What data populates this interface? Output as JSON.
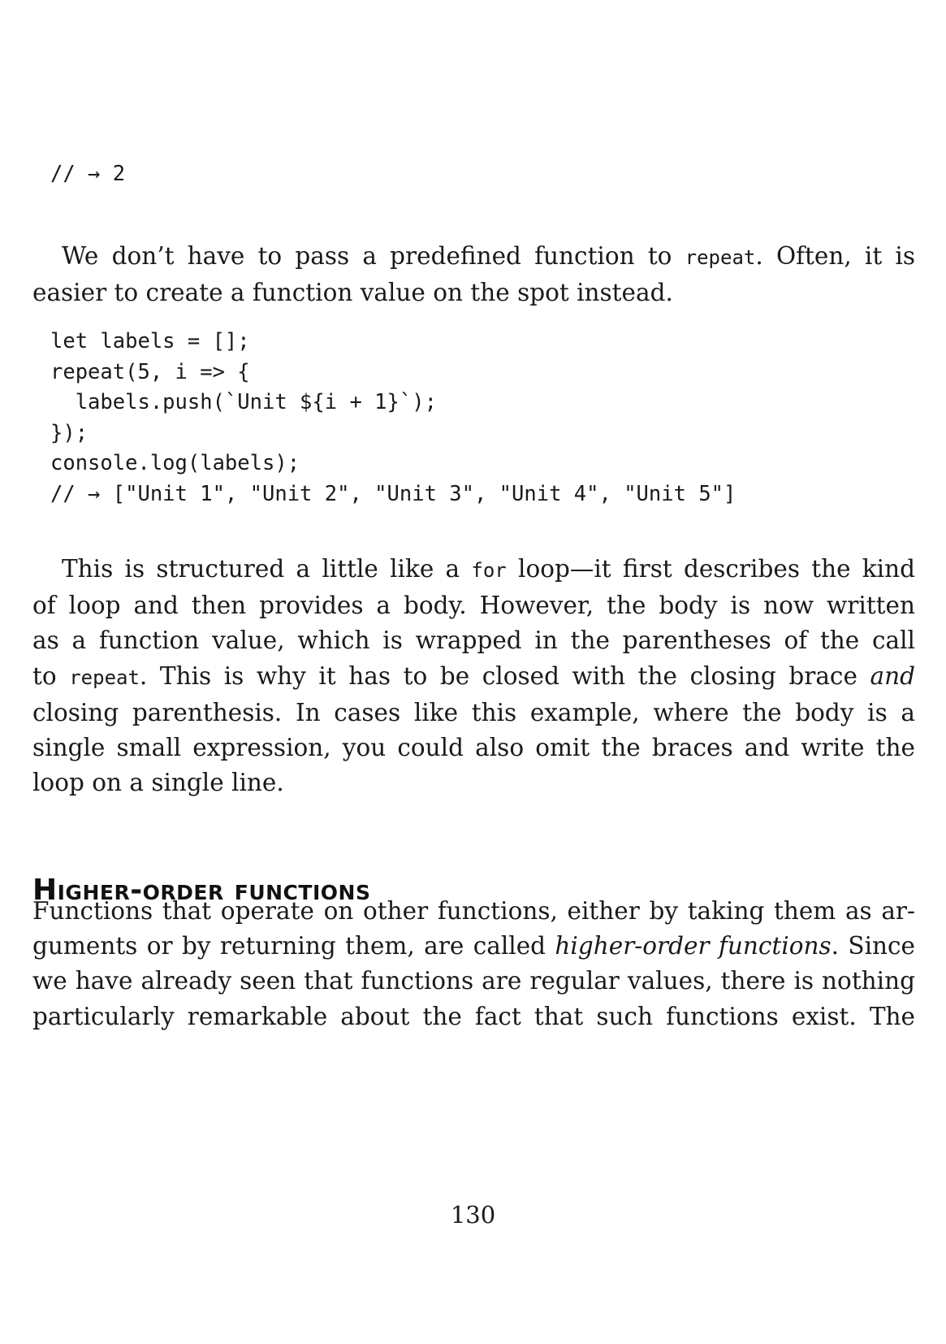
{
  "code_top": "// → 2",
  "para1": {
    "l1_a": "We don’t have to pass a predefined function to ",
    "l1_code": "repeat",
    "l1_b": ". Often, it is",
    "l2": "easier to create a function value on the spot instead."
  },
  "code_block": [
    "let labels = [];",
    "repeat(5, i => {",
    "  labels.push(`Unit ${i + 1}`);",
    "});",
    "console.log(labels);",
    "// → [\"Unit 1\", \"Unit 2\", \"Unit 3\", \"Unit 4\", \"Unit 5\"]"
  ],
  "para2": {
    "l1_a": "This is structured a little like a ",
    "l1_code": "for",
    "l1_b": " loop—it first describes the kind",
    "l2": "of loop and then provides a body. However, the body is now written",
    "l3": "as a function value, which is wrapped in the parentheses of the call",
    "l4_a": "to ",
    "l4_code": "repeat",
    "l4_b": ". This is why it has to be closed with the closing brace ",
    "l4_em": "and",
    "l5": "closing parenthesis. In cases like this example, where the body is a",
    "l6": "single small expression, you could also omit the braces and write the",
    "l7": "loop on a single line."
  },
  "heading": "Higher-order functions",
  "para3": {
    "l1": "Functions that operate on other functions, either by taking them as ar-",
    "l2_a": "guments or by returning them, are called ",
    "l2_em": "higher-order functions",
    "l2_b": ". Since",
    "l3": "we have already seen that functions are regular values, there is nothing",
    "l4": "particularly remarkable about the fact that such functions exist. The"
  },
  "page_number": "130"
}
